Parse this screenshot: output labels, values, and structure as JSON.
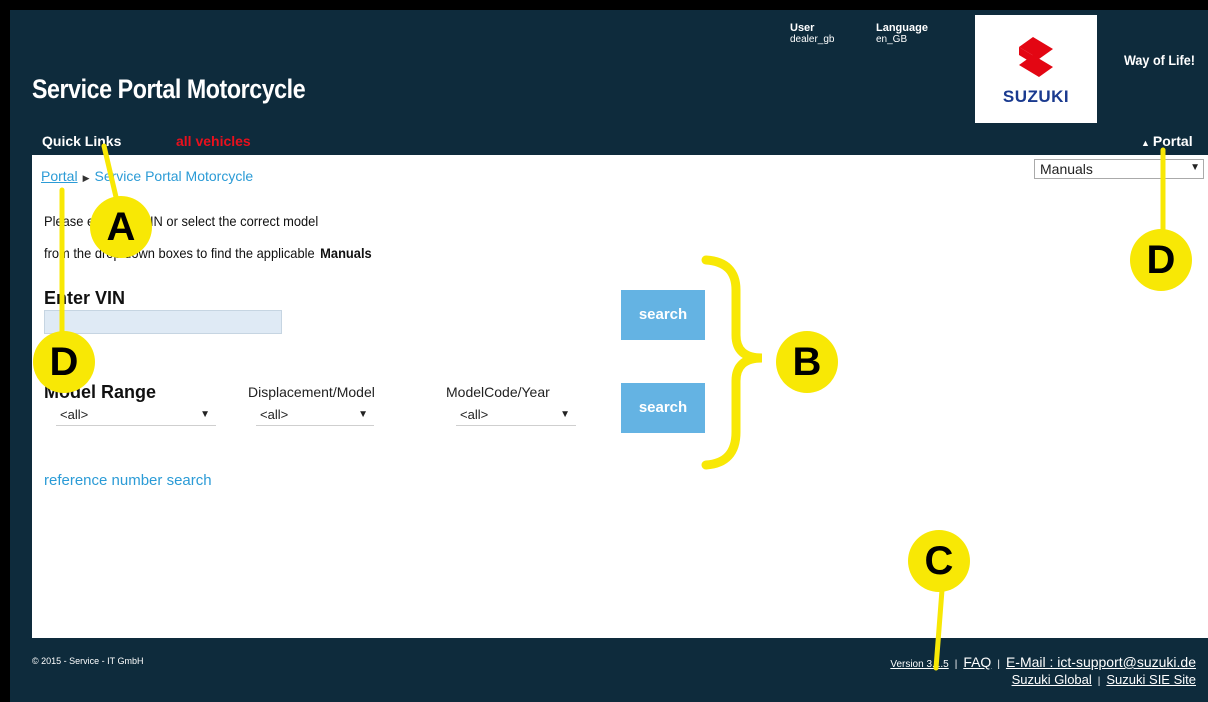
{
  "header": {
    "title": "Service Portal Motorcycle",
    "user_label": "User",
    "user_value": "dealer_gb",
    "language_label": "Language",
    "language_value": "en_GB",
    "brand_wordmark": "SUZUKI",
    "tagline": "Way of Life!",
    "brand_color": "#1a3a8f",
    "logo_red": "#e30613"
  },
  "nav": {
    "quick_links": "Quick Links",
    "all_vehicles": "all vehicles",
    "portal": "Portal",
    "portal_icon": "triangle-up-icon",
    "manuals_select": "Manuals"
  },
  "breadcrumb": {
    "root": "Portal",
    "current": "Service Portal Motorcycle"
  },
  "intro": {
    "line1": "Please enter the VIN or select the correct model",
    "line2": "from the drop down boxes to find the applicable",
    "line2_bold": "Manuals"
  },
  "vin": {
    "label": "Enter VIN",
    "value": "",
    "search_label": "search"
  },
  "model": {
    "range_label": "Model Range",
    "displacement_label": "Displacement/Model",
    "modelcode_label": "ModelCode/Year",
    "range_value": "<all>",
    "displacement_value": "<all>",
    "modelcode_value": "<all>",
    "search_label": "search"
  },
  "reference_search": "reference number search",
  "footer": {
    "copyright": "© 2015 - Service - IT GmbH",
    "version": "Version 3.1.5",
    "faq": "FAQ",
    "email": "E-Mail : ict-support@suzuki.de",
    "global": "Suzuki Global",
    "sie": "Suzuki SIE Site"
  },
  "annotations": {
    "a": "A",
    "b": "B",
    "c": "C",
    "d1": "D",
    "d2": "D",
    "color": "#f8e805"
  },
  "colors": {
    "header_bg": "#0e2b3c",
    "link_blue": "#2b9bd6",
    "button_blue": "#64b3e3",
    "alert_red": "#e8101d"
  }
}
